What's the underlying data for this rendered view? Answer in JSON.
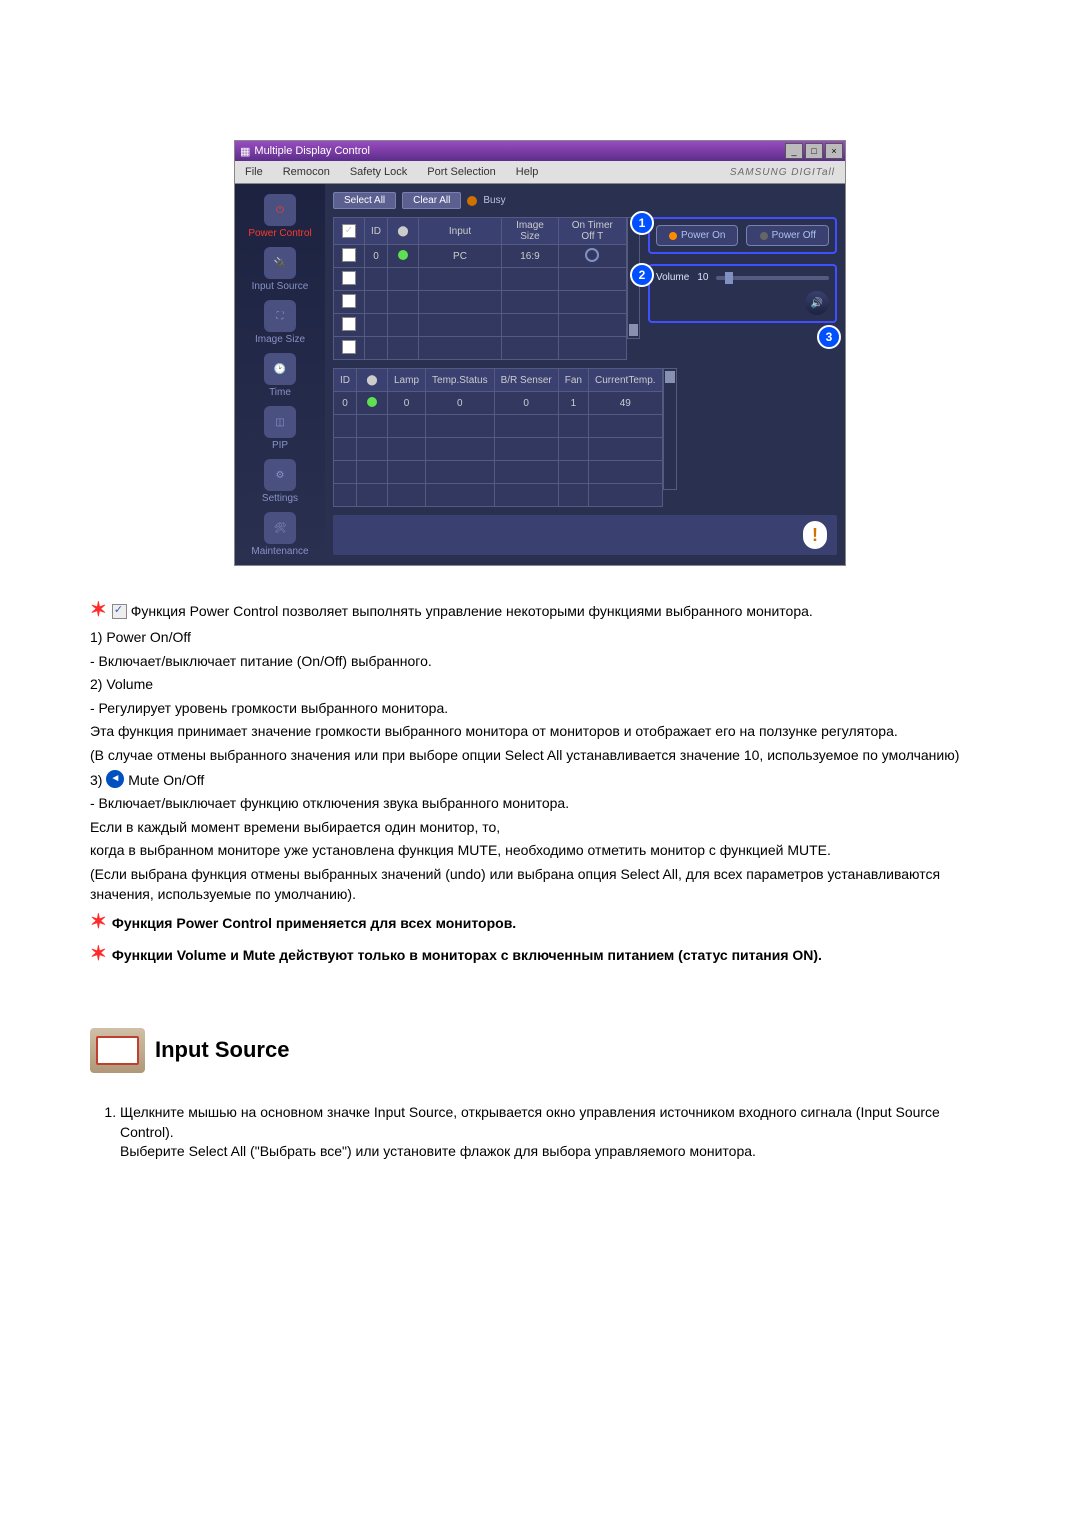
{
  "app": {
    "title": "Multiple Display Control",
    "brand": "SAMSUNG DIGITall",
    "menu": [
      "File",
      "Remocon",
      "Safety Lock",
      "Port Selection",
      "Help"
    ],
    "sidebar": [
      {
        "label": "Power Control"
      },
      {
        "label": "Input Source"
      },
      {
        "label": "Image Size"
      },
      {
        "label": "Time"
      },
      {
        "label": "PIP"
      },
      {
        "label": "Settings"
      },
      {
        "label": "Maintenance"
      }
    ],
    "toolbar": {
      "select_all": "Select All",
      "clear_all": "Clear All",
      "busy": "Busy"
    },
    "grid1": {
      "headers": [
        "",
        "ID",
        "",
        "Input",
        "Image Size",
        "On Timer Off T"
      ],
      "row": {
        "id": "0",
        "input": "PC",
        "image_size": "16:9"
      }
    },
    "grid2": {
      "headers": [
        "ID",
        "",
        "Lamp",
        "Temp.Status",
        "B/R Senser",
        "Fan",
        "CurrentTemp."
      ],
      "row": {
        "id": "0",
        "lamp": "0",
        "temp_status": "0",
        "br": "0",
        "fan": "1",
        "cur_temp": "49"
      }
    },
    "right": {
      "power_on": "Power On",
      "power_off": "Power Off",
      "volume_label": "Volume",
      "volume_value": "10"
    },
    "callouts": {
      "c1": "1",
      "c2": "2",
      "c3": "3"
    }
  },
  "doc": {
    "intro": "Функция Power Control позволяет выполнять управление некоторыми функциями выбранного монитора.",
    "i1_title": "1)  Power On/Off",
    "i1_line": "- Включает/выключает питание (On/Off) выбранного.",
    "i2_title": "2)  Volume",
    "i2_l1": "- Регулирует уровень громкости выбранного монитора.",
    "i2_l2": "Эта функция принимает значение громкости выбранного монитора от мониторов и отображает его на ползунке регулятора.",
    "i2_l3": "(В случае отмены выбранного значения или при выборе опции Select All устанавливается значение 10, используемое по умолчанию)",
    "i3_title_num": "3) ",
    "i3_title_text": " Mute On/Off",
    "i3_l1": "- Включает/выключает функцию отключения звука выбранного монитора.",
    "i3_l2": "Если в каждый момент времени выбирается один монитор, то,",
    "i3_l3": "когда в выбранном мониторе уже установлена функция MUTE, необходимо отметить монитор с функцией MUTE.",
    "i3_l4": "(Если выбрана функция отмены выбранных значений (undo) или выбрана опция Select All, для всех параметров устанавливаются значения, используемые по умолчанию).",
    "note1": "Функция Power Control применяется для всех мониторов.",
    "note2": "Функции Volume и Mute действуют только в мониторах с включенным питанием (статус питания ON).",
    "section_title": "Input Source",
    "ol1a": "Щелкните мышью на основном значке Input Source, открывается окно управления источником входного сигнала (Input Source Control).",
    "ol1b": "Выберите Select All (\"Выбрать все\") или установите флажок для выбора управляемого монитора."
  }
}
